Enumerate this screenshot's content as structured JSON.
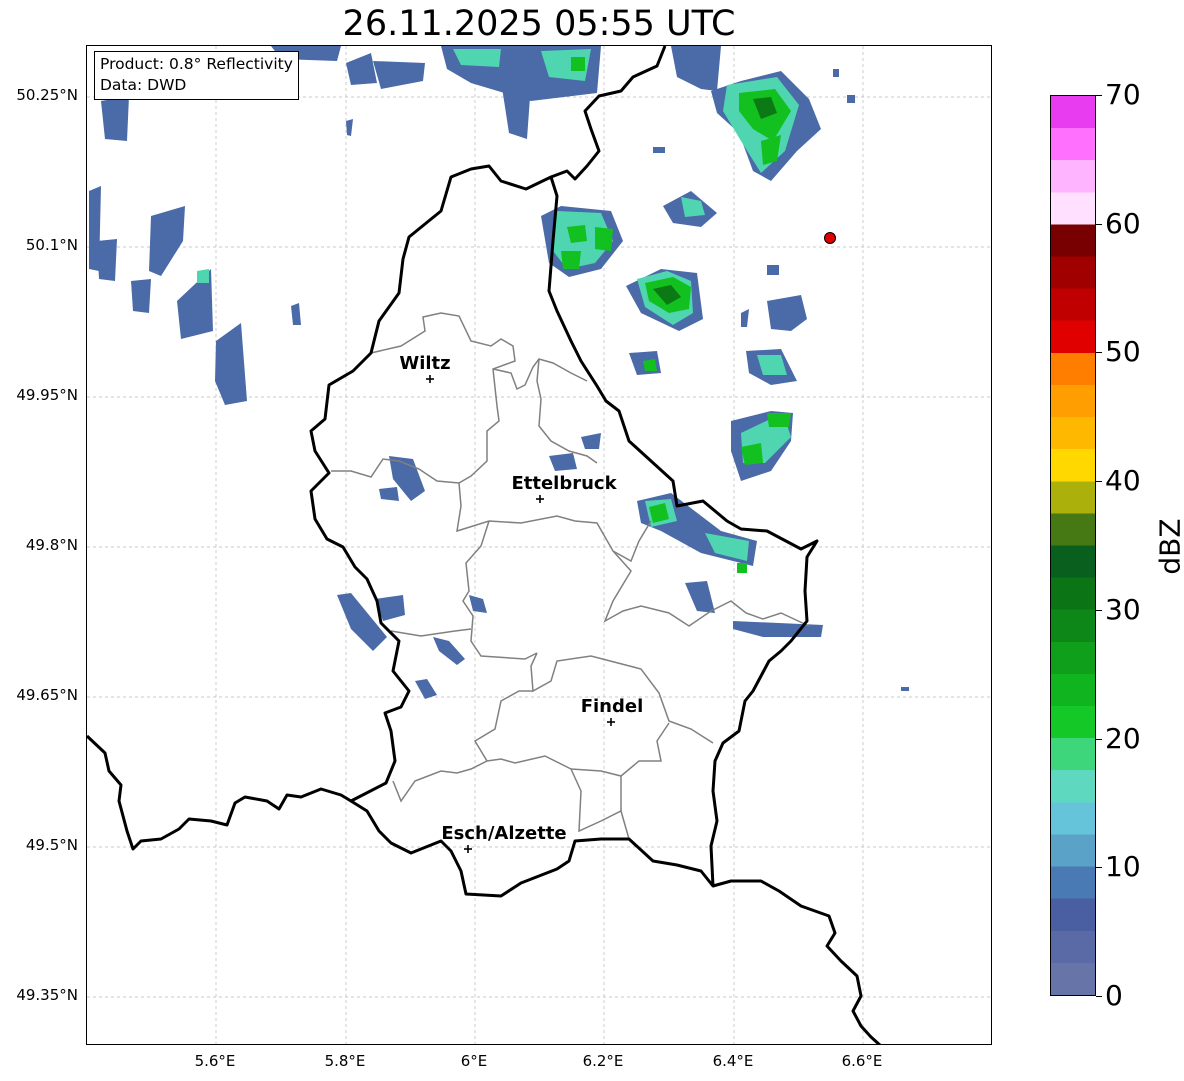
{
  "title": "26.11.2025 05:55 UTC",
  "info": {
    "product": "Product: 0.8° Reflectivity",
    "data": "Data: DWD"
  },
  "lat_labels": [
    "50.25°N",
    "50.1°N",
    "49.95°N",
    "49.8°N",
    "49.65°N",
    "49.5°N",
    "49.35°N"
  ],
  "lon_labels": [
    "5.6°E",
    "5.8°E",
    "6°E",
    "6.2°E",
    "6.4°E",
    "6.6°E"
  ],
  "cities": [
    {
      "name": "Wiltz"
    },
    {
      "name": "Ettelbruck"
    },
    {
      "name": "Findel"
    },
    {
      "name": "Esch/Alzette"
    }
  ],
  "colorbar": {
    "label": "dBZ",
    "ticks": [
      "0",
      "10",
      "20",
      "30",
      "40",
      "50",
      "60",
      "70"
    ],
    "colors": [
      "#6674a8",
      "#5a6aa6",
      "#4a5fa2",
      "#4a7ab4",
      "#5aa2c8",
      "#66c4da",
      "#5fd8c0",
      "#3ed67a",
      "#14c828",
      "#10b41e",
      "#0f9f1a",
      "#0d8818",
      "#0b7414",
      "#09601e",
      "#467814",
      "#acb00a",
      "#ffd800",
      "#ffb800",
      "#ff9e00",
      "#ff7e00",
      "#e00000",
      "#c00000",
      "#a00000",
      "#780000",
      "#ffe0ff",
      "#ffb4ff",
      "#ff70ff",
      "#e83cf0"
    ]
  },
  "marker": {
    "color": "#e00000"
  }
}
